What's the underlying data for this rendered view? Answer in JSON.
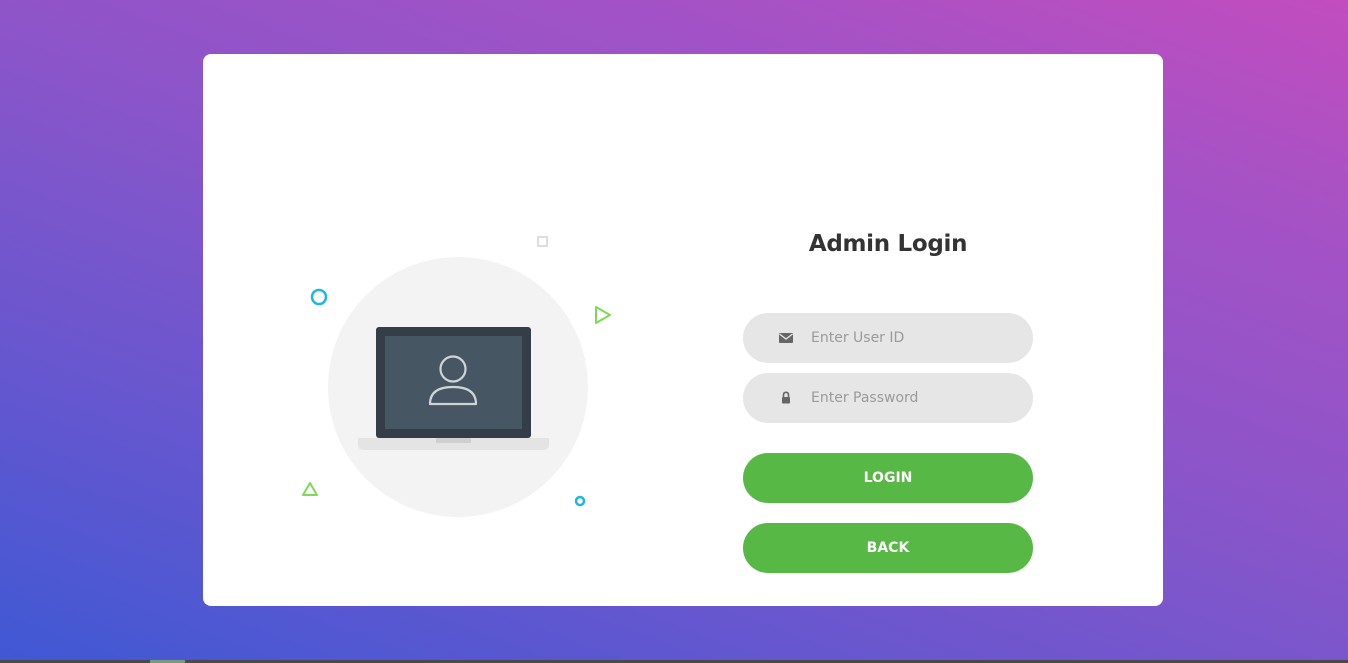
{
  "login_form": {
    "title": "Admin Login",
    "user_id_placeholder": "Enter User ID",
    "password_placeholder": "Enter Password",
    "login_label": "LOGIN",
    "back_label": "BACK"
  },
  "icons": {
    "user_id_field": "envelope-icon",
    "password_field": "lock-icon",
    "illustration": "laptop-user-icon"
  },
  "colors": {
    "primary_button": "#57b846",
    "input_background": "#e6e6e6",
    "background_gradient": [
      "#3f58d4",
      "#8c55c9",
      "#c24dbf"
    ],
    "card": "#ffffff",
    "deco_blue": "#1cb7e6",
    "deco_green": "#7ed957"
  }
}
